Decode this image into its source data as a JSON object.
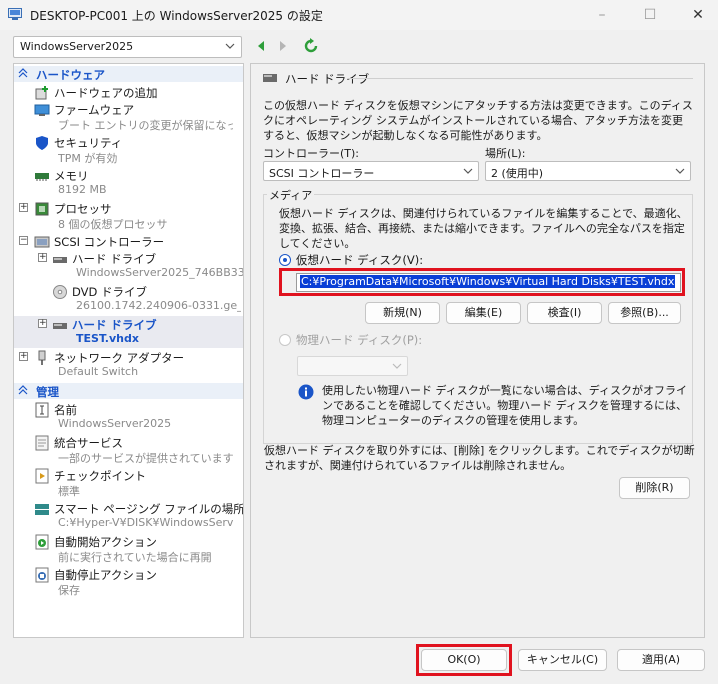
{
  "window": {
    "title": "DESKTOP-PC001 上の WindowsServer2025 の設定"
  },
  "vm_selector": {
    "value": "WindowsServer2025"
  },
  "tree": {
    "hardware_header": "ハードウェア",
    "management_header": "管理",
    "items": [
      {
        "id": "add-hardware",
        "title": "ハードウェアの追加",
        "sub": ""
      },
      {
        "id": "firmware",
        "title": "ファームウェア",
        "sub": "ブート エントリの変更が保留になって..."
      },
      {
        "id": "security",
        "title": "セキュリティ",
        "sub": "TPM が有効"
      },
      {
        "id": "memory",
        "title": "メモリ",
        "sub": "8192 MB"
      },
      {
        "id": "processor",
        "title": "プロセッサ",
        "sub": "8 個の仮想プロセッサ"
      },
      {
        "id": "scsi",
        "title": "SCSI コントローラー",
        "sub": ""
      },
      {
        "id": "hdd1",
        "title": "ハード ドライブ",
        "sub": "WindowsServer2025_746BB33..."
      },
      {
        "id": "dvd",
        "title": "DVD ドライブ",
        "sub": "26100.1742.240906-0331.ge_..."
      },
      {
        "id": "hdd2",
        "title": "ハード ドライブ",
        "sub": "TEST.vhdx"
      },
      {
        "id": "network",
        "title": "ネットワーク アダプター",
        "sub": "Default Switch"
      },
      {
        "id": "name",
        "title": "名前",
        "sub": "WindowsServer2025"
      },
      {
        "id": "integration",
        "title": "統合サービス",
        "sub": "一部のサービスが提供されています"
      },
      {
        "id": "checkpoint",
        "title": "チェックポイント",
        "sub": "標準"
      },
      {
        "id": "paging",
        "title": "スマート ページング ファイルの場所",
        "sub": "C:¥Hyper-V¥DISK¥WindowsServer..."
      },
      {
        "id": "autostart",
        "title": "自動開始アクション",
        "sub": "前に実行されていた場合に再開"
      },
      {
        "id": "autostop",
        "title": "自動停止アクション",
        "sub": "保存"
      }
    ]
  },
  "panel": {
    "title": "ハード ドライブ",
    "description": "この仮想ハード ディスクを仮想マシンにアタッチする方法は変更できます。このディスクにオペレーティング システムがインストールされている場合、アタッチ方法を変更すると、仮想マシンが起動しなくなる可能性があります。",
    "controller_label": "コントローラー(T):",
    "controller_value": "SCSI コントローラー",
    "location_label": "場所(L):",
    "location_value": "2 (使用中)",
    "media_label": "メディア",
    "media_description": "仮想ハード ディスクは、関連付けられているファイルを編集することで、最適化、変換、拡張、結合、再接続、または縮小できます。ファイルへの完全なパスを指定してください。",
    "vhd_radio_label": "仮想ハード ディスク(V):",
    "vhd_path": "C:¥ProgramData¥Microsoft¥Windows¥Virtual Hard Disks¥TEST.vhdx",
    "btn_new": "新規(N)",
    "btn_edit": "編集(E)",
    "btn_inspect": "検査(I)",
    "btn_browse": "参照(B)...",
    "phys_radio_label": "物理ハード ディスク(P):",
    "info_text": "使用したい物理ハード ディスクが一覧にない場合は、ディスクがオフラインであることを確認してください。物理ハード ディスクを管理するには、物理コンピューターのディスクの管理を使用します。",
    "remove_description": "仮想ハード ディスクを取り外すには、[削除] をクリックします。これでディスクが切断されますが、関連付けられているファイルは削除されません。",
    "btn_remove": "削除(R)"
  },
  "footer": {
    "ok": "OK(O)",
    "cancel": "キャンセル(C)",
    "apply": "適用(A)"
  },
  "colors": {
    "accent": "#1a55c8",
    "highlight": "#e0121e",
    "selection": "#0a3fd6"
  }
}
